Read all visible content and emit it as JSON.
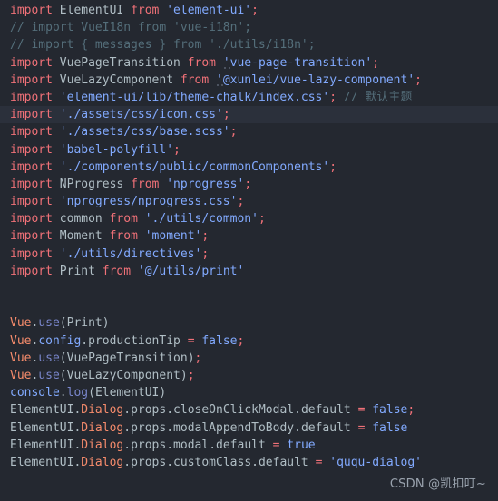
{
  "editor": {
    "background": "#242830",
    "current_line_background": "#2B303B",
    "default_text_color": "#B0BEC5",
    "language": "javascript",
    "current_line_index": 6
  },
  "palette": {
    "keyword": "#F07178",
    "string": "#82AAFF",
    "comment": "#546E7A",
    "identifier": "#B0BEC5",
    "object": "#F78C6C",
    "property": "#82AAFF",
    "function": "#7986CB",
    "boolean": "#82AAFF",
    "punctuation": "#F07178"
  },
  "watermark": {
    "text": "CSDN @凯扣叮~"
  },
  "lines": [
    {
      "index": 0,
      "current": false,
      "tokens": [
        {
          "t": "import",
          "c": "kw"
        },
        {
          "t": " ",
          "c": "plain"
        },
        {
          "t": "ElementUI",
          "c": "id"
        },
        {
          "t": " ",
          "c": "plain"
        },
        {
          "t": "from",
          "c": "kw"
        },
        {
          "t": " ",
          "c": "plain"
        },
        {
          "t": "'element-ui'",
          "c": "str"
        },
        {
          "t": ";",
          "c": "punc"
        }
      ]
    },
    {
      "index": 1,
      "current": false,
      "tokens": [
        {
          "t": "// import VueI18n from 'vue-i18n';",
          "c": "com"
        }
      ]
    },
    {
      "index": 2,
      "current": false,
      "tokens": [
        {
          "t": "// import { messages } from './utils/i18n';",
          "c": "com"
        }
      ]
    },
    {
      "index": 3,
      "current": false,
      "tokens": [
        {
          "t": "import",
          "c": "kw"
        },
        {
          "t": " ",
          "c": "plain"
        },
        {
          "t": "VuePageTransition",
          "c": "id"
        },
        {
          "t": " ",
          "c": "plain"
        },
        {
          "t": "from",
          "c": "kw"
        },
        {
          "t": " ",
          "c": "plain"
        },
        {
          "t": "'",
          "c": "str-mark"
        },
        {
          "t": "vue-page-transition'",
          "c": "str"
        },
        {
          "t": ";",
          "c": "punc"
        }
      ]
    },
    {
      "index": 4,
      "current": false,
      "tokens": [
        {
          "t": "import",
          "c": "kw"
        },
        {
          "t": " ",
          "c": "plain"
        },
        {
          "t": "VueLazyComponent",
          "c": "id"
        },
        {
          "t": " ",
          "c": "plain"
        },
        {
          "t": "from",
          "c": "kw"
        },
        {
          "t": " ",
          "c": "plain"
        },
        {
          "t": "'",
          "c": "str-mark"
        },
        {
          "t": "@xunlei/vue-lazy-component'",
          "c": "str"
        },
        {
          "t": ";",
          "c": "punc"
        }
      ]
    },
    {
      "index": 5,
      "current": false,
      "tokens": [
        {
          "t": "import",
          "c": "kw"
        },
        {
          "t": " ",
          "c": "plain"
        },
        {
          "t": "'element-ui/lib/theme-chalk/index.css'",
          "c": "str"
        },
        {
          "t": ";",
          "c": "punc"
        },
        {
          "t": " ",
          "c": "plain"
        },
        {
          "t": "// 默认主题",
          "c": "com"
        }
      ]
    },
    {
      "index": 6,
      "current": true,
      "tokens": [
        {
          "t": "import",
          "c": "kw"
        },
        {
          "t": " ",
          "c": "plain"
        },
        {
          "t": "'./assets/css/icon.css'",
          "c": "str"
        },
        {
          "t": ";",
          "c": "punc"
        }
      ]
    },
    {
      "index": 7,
      "current": false,
      "tokens": [
        {
          "t": "import",
          "c": "kw"
        },
        {
          "t": " ",
          "c": "plain"
        },
        {
          "t": "'./assets/css/base.scss'",
          "c": "str"
        },
        {
          "t": ";",
          "c": "punc"
        }
      ]
    },
    {
      "index": 8,
      "current": false,
      "tokens": [
        {
          "t": "import",
          "c": "kw"
        },
        {
          "t": " ",
          "c": "plain"
        },
        {
          "t": "'babel-polyfill'",
          "c": "str"
        },
        {
          "t": ";",
          "c": "punc"
        }
      ]
    },
    {
      "index": 9,
      "current": false,
      "tokens": [
        {
          "t": "import",
          "c": "kw"
        },
        {
          "t": " ",
          "c": "plain"
        },
        {
          "t": "'./components/public/commonComponents'",
          "c": "str"
        },
        {
          "t": ";",
          "c": "punc"
        }
      ]
    },
    {
      "index": 10,
      "current": false,
      "tokens": [
        {
          "t": "import",
          "c": "kw"
        },
        {
          "t": " ",
          "c": "plain"
        },
        {
          "t": "NProgress",
          "c": "id"
        },
        {
          "t": " ",
          "c": "plain"
        },
        {
          "t": "from",
          "c": "kw"
        },
        {
          "t": " ",
          "c": "plain"
        },
        {
          "t": "'nprogress'",
          "c": "str"
        },
        {
          "t": ";",
          "c": "punc"
        }
      ]
    },
    {
      "index": 11,
      "current": false,
      "tokens": [
        {
          "t": "import",
          "c": "kw"
        },
        {
          "t": " ",
          "c": "plain"
        },
        {
          "t": "'nprogress/nprogress.css'",
          "c": "str"
        },
        {
          "t": ";",
          "c": "punc"
        }
      ]
    },
    {
      "index": 12,
      "current": false,
      "tokens": [
        {
          "t": "import",
          "c": "kw"
        },
        {
          "t": " ",
          "c": "plain"
        },
        {
          "t": "common",
          "c": "id"
        },
        {
          "t": " ",
          "c": "plain"
        },
        {
          "t": "from",
          "c": "kw"
        },
        {
          "t": " ",
          "c": "plain"
        },
        {
          "t": "'./utils/common'",
          "c": "str"
        },
        {
          "t": ";",
          "c": "punc"
        }
      ]
    },
    {
      "index": 13,
      "current": false,
      "tokens": [
        {
          "t": "import",
          "c": "kw"
        },
        {
          "t": " ",
          "c": "plain"
        },
        {
          "t": "Moment",
          "c": "id"
        },
        {
          "t": " ",
          "c": "plain"
        },
        {
          "t": "from",
          "c": "kw"
        },
        {
          "t": " ",
          "c": "plain"
        },
        {
          "t": "'moment'",
          "c": "str"
        },
        {
          "t": ";",
          "c": "punc"
        }
      ]
    },
    {
      "index": 14,
      "current": false,
      "tokens": [
        {
          "t": "import",
          "c": "kw"
        },
        {
          "t": " ",
          "c": "plain"
        },
        {
          "t": "'./utils/directives'",
          "c": "str"
        },
        {
          "t": ";",
          "c": "punc"
        }
      ]
    },
    {
      "index": 15,
      "current": false,
      "tokens": [
        {
          "t": "import",
          "c": "kw"
        },
        {
          "t": " ",
          "c": "plain"
        },
        {
          "t": "Print",
          "c": "id"
        },
        {
          "t": " ",
          "c": "plain"
        },
        {
          "t": "from",
          "c": "kw"
        },
        {
          "t": " ",
          "c": "plain"
        },
        {
          "t": "'@/utils/print'",
          "c": "str"
        }
      ]
    },
    {
      "index": 16,
      "current": false,
      "tokens": []
    },
    {
      "index": 17,
      "current": false,
      "tokens": []
    },
    {
      "index": 18,
      "current": false,
      "tokens": [
        {
          "t": "Vue",
          "c": "obj"
        },
        {
          "t": ".",
          "c": "plain"
        },
        {
          "t": "use",
          "c": "fn"
        },
        {
          "t": "(",
          "c": "paren"
        },
        {
          "t": "Print",
          "c": "id"
        },
        {
          "t": ")",
          "c": "paren"
        }
      ]
    },
    {
      "index": 19,
      "current": false,
      "tokens": [
        {
          "t": "Vue",
          "c": "obj"
        },
        {
          "t": ".",
          "c": "plain"
        },
        {
          "t": "config",
          "c": "prop"
        },
        {
          "t": ".",
          "c": "plain"
        },
        {
          "t": "productionTip",
          "c": "id"
        },
        {
          "t": " ",
          "c": "plain"
        },
        {
          "t": "=",
          "c": "punc"
        },
        {
          "t": " ",
          "c": "plain"
        },
        {
          "t": "false",
          "c": "bool"
        },
        {
          "t": ";",
          "c": "punc"
        }
      ]
    },
    {
      "index": 20,
      "current": false,
      "tokens": [
        {
          "t": "Vue",
          "c": "obj"
        },
        {
          "t": ".",
          "c": "plain"
        },
        {
          "t": "use",
          "c": "fn"
        },
        {
          "t": "(",
          "c": "paren"
        },
        {
          "t": "VuePageTransition",
          "c": "id"
        },
        {
          "t": ")",
          "c": "paren"
        },
        {
          "t": ";",
          "c": "punc"
        }
      ]
    },
    {
      "index": 21,
      "current": false,
      "tokens": [
        {
          "t": "Vue",
          "c": "obj"
        },
        {
          "t": ".",
          "c": "plain"
        },
        {
          "t": "use",
          "c": "fn"
        },
        {
          "t": "(",
          "c": "paren"
        },
        {
          "t": "VueLazyComponent",
          "c": "id"
        },
        {
          "t": ")",
          "c": "paren"
        },
        {
          "t": ";",
          "c": "punc"
        }
      ]
    },
    {
      "index": 22,
      "current": false,
      "tokens": [
        {
          "t": "console",
          "c": "str"
        },
        {
          "t": ".",
          "c": "plain"
        },
        {
          "t": "log",
          "c": "fn"
        },
        {
          "t": "(",
          "c": "paren"
        },
        {
          "t": "ElementUI",
          "c": "id"
        },
        {
          "t": ")",
          "c": "paren"
        }
      ]
    },
    {
      "index": 23,
      "current": false,
      "tokens": [
        {
          "t": "ElementUI",
          "c": "id"
        },
        {
          "t": ".",
          "c": "plain"
        },
        {
          "t": "Dialog",
          "c": "obj"
        },
        {
          "t": ".",
          "c": "plain"
        },
        {
          "t": "props",
          "c": "id"
        },
        {
          "t": ".",
          "c": "plain"
        },
        {
          "t": "closeOnClickModal",
          "c": "id"
        },
        {
          "t": ".",
          "c": "plain"
        },
        {
          "t": "default",
          "c": "id"
        },
        {
          "t": " ",
          "c": "plain"
        },
        {
          "t": "=",
          "c": "punc"
        },
        {
          "t": " ",
          "c": "plain"
        },
        {
          "t": "false",
          "c": "bool"
        },
        {
          "t": ";",
          "c": "punc"
        }
      ]
    },
    {
      "index": 24,
      "current": false,
      "tokens": [
        {
          "t": "ElementUI",
          "c": "id"
        },
        {
          "t": ".",
          "c": "plain"
        },
        {
          "t": "Dialog",
          "c": "obj"
        },
        {
          "t": ".",
          "c": "plain"
        },
        {
          "t": "props",
          "c": "id"
        },
        {
          "t": ".",
          "c": "plain"
        },
        {
          "t": "modalAppendToBody",
          "c": "id"
        },
        {
          "t": ".",
          "c": "plain"
        },
        {
          "t": "default",
          "c": "id"
        },
        {
          "t": " ",
          "c": "plain"
        },
        {
          "t": "=",
          "c": "punc"
        },
        {
          "t": " ",
          "c": "plain"
        },
        {
          "t": "false",
          "c": "bool"
        }
      ]
    },
    {
      "index": 25,
      "current": false,
      "tokens": [
        {
          "t": "ElementUI",
          "c": "id"
        },
        {
          "t": ".",
          "c": "plain"
        },
        {
          "t": "Dialog",
          "c": "obj"
        },
        {
          "t": ".",
          "c": "plain"
        },
        {
          "t": "props",
          "c": "id"
        },
        {
          "t": ".",
          "c": "plain"
        },
        {
          "t": "modal",
          "c": "id"
        },
        {
          "t": ".",
          "c": "plain"
        },
        {
          "t": "default",
          "c": "id"
        },
        {
          "t": " ",
          "c": "plain"
        },
        {
          "t": "=",
          "c": "punc"
        },
        {
          "t": " ",
          "c": "plain"
        },
        {
          "t": "true",
          "c": "bool"
        }
      ]
    },
    {
      "index": 26,
      "current": false,
      "tokens": [
        {
          "t": "ElementUI",
          "c": "id"
        },
        {
          "t": ".",
          "c": "plain"
        },
        {
          "t": "Dialog",
          "c": "obj"
        },
        {
          "t": ".",
          "c": "plain"
        },
        {
          "t": "props",
          "c": "id"
        },
        {
          "t": ".",
          "c": "plain"
        },
        {
          "t": "customClass",
          "c": "id"
        },
        {
          "t": ".",
          "c": "plain"
        },
        {
          "t": "default",
          "c": "id"
        },
        {
          "t": " ",
          "c": "plain"
        },
        {
          "t": "=",
          "c": "punc"
        },
        {
          "t": " ",
          "c": "plain"
        },
        {
          "t": "'ququ-dialog'",
          "c": "str"
        }
      ]
    }
  ]
}
